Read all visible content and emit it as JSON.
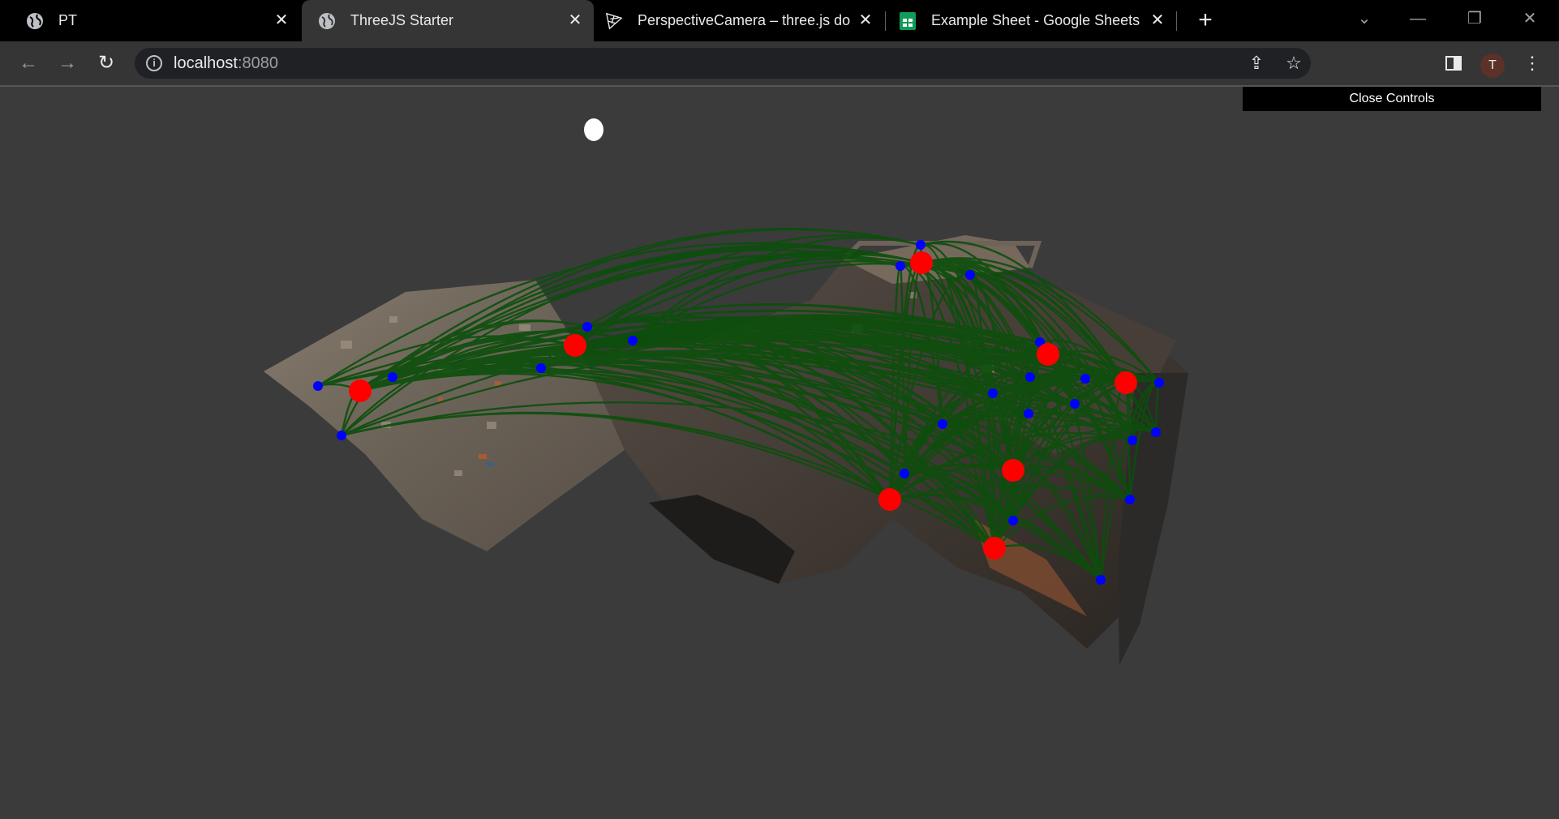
{
  "browser": {
    "tabs": [
      {
        "title": "PT",
        "favicon": "globe-icon",
        "active": false
      },
      {
        "title": "ThreeJS Starter",
        "favicon": "globe-icon",
        "active": true
      },
      {
        "title": "PerspectiveCamera – three.js doc",
        "favicon": "threejs-icon",
        "active": false
      },
      {
        "title": "Example Sheet - Google Sheets",
        "favicon": "sheets-icon",
        "active": false
      }
    ],
    "url_host": "localhost",
    "url_port": ":8080",
    "profile_initial": "T"
  },
  "app": {
    "close_controls_label": "Close Controls"
  },
  "colors": {
    "node_major": "#ff0000",
    "node_minor": "#0000ff",
    "edge": "#0b4f0b",
    "background": "#3b3b3b"
  }
}
